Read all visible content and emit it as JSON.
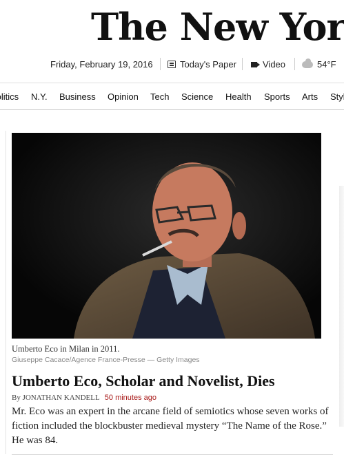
{
  "masthead": {
    "title": "The New York Times"
  },
  "infobar": {
    "date": "Friday, February 19, 2016",
    "todays_paper": "Today's Paper",
    "video": "Video",
    "temperature": "54°F"
  },
  "nav": {
    "items": [
      "Politics",
      "N.Y.",
      "Business",
      "Opinion",
      "Tech",
      "Science",
      "Health",
      "Sports",
      "Arts",
      "Style"
    ]
  },
  "article": {
    "caption": "Umberto Eco in Milan in 2011.",
    "credit": "Giuseppe Cacace/Agence France-Presse — Getty Images",
    "headline": "Umberto Eco, Scholar and Novelist, Dies",
    "byline_author": "By JONATHAN KANDELL",
    "byline_time": "50 minutes ago",
    "summary": "Mr. Eco was an expert in the arcane field of semiotics whose seven works of fiction included the blockbuster medieval mystery “The Name of the Rose.” He was 84."
  },
  "colors": {
    "accent_time": "#a81817",
    "text": "#111111"
  }
}
